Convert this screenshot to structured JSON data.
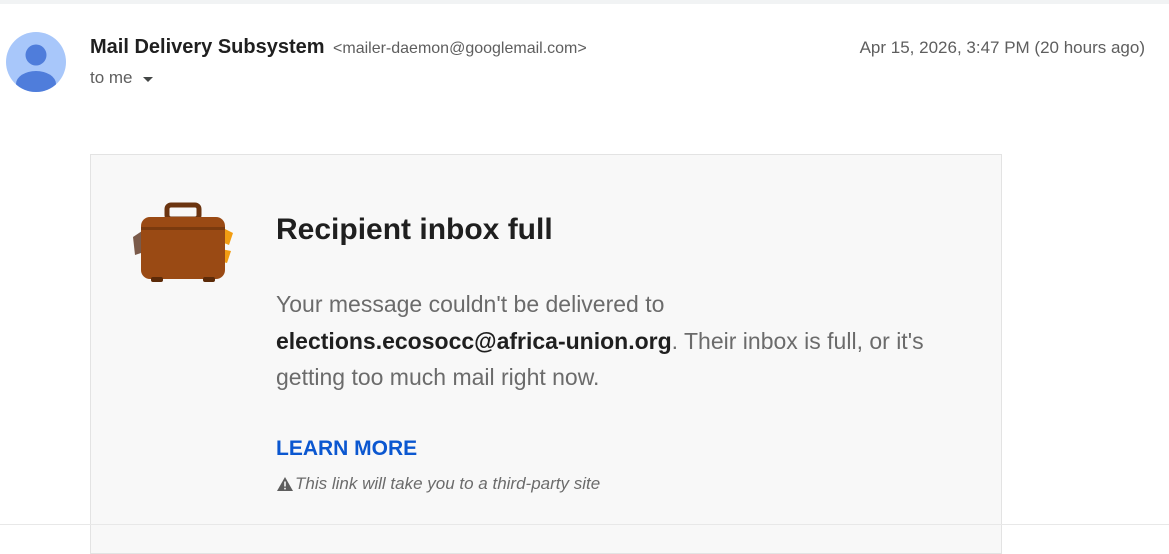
{
  "header": {
    "sender_name": "Mail Delivery Subsystem",
    "sender_email": "<mailer-daemon@googlemail.com>",
    "date": "Apr 15, 2026, 3:47 PM (20 hours ago)",
    "to_label": "to me",
    "avatar_icon": "person-icon"
  },
  "bounce_card": {
    "icon": "suitcase-icon",
    "title": "Recipient inbox full",
    "message_prefix": "Your message couldn't be delivered to",
    "recipient": "elections.ecosocc@africa-union.org",
    "message_suffix": ". Their inbox is full, or it's getting too much mail right now.",
    "learn_more_label": "LEARN MORE",
    "third_party_note": "This link will take you to a third-party site",
    "warning_icon": "warning-icon"
  },
  "colors": {
    "avatar_bg": "#a8c7fa",
    "avatar_figure": "#4f7ddb",
    "link_blue": "#0b57d0",
    "suitcase_brown": "#9a4a14",
    "suitcase_accent": "#f29d12"
  }
}
